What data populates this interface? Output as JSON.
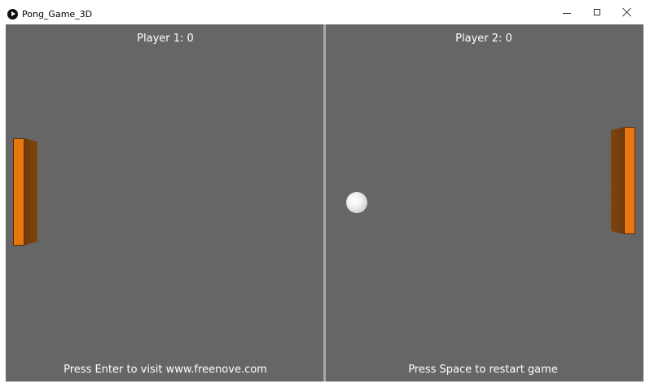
{
  "window": {
    "title": "Pong_Game_3D",
    "app_icon": "play-circle-icon",
    "controls": {
      "minimize_icon": "minimize-icon",
      "maximize_icon": "maximize-icon",
      "close_icon": "close-icon"
    }
  },
  "game": {
    "player1_score": "Player 1: 0",
    "player2_score": "Player 2: 0",
    "left_hint": "Press Enter to visit www.freenove.com",
    "right_hint": "Press Space to restart game",
    "colors": {
      "background": "#666666",
      "net": "#a8a8a8",
      "paddle_front": "#e8760e",
      "paddle_side": "#7a420c",
      "ball": "#f2f2f2",
      "text": "#ffffff"
    }
  }
}
